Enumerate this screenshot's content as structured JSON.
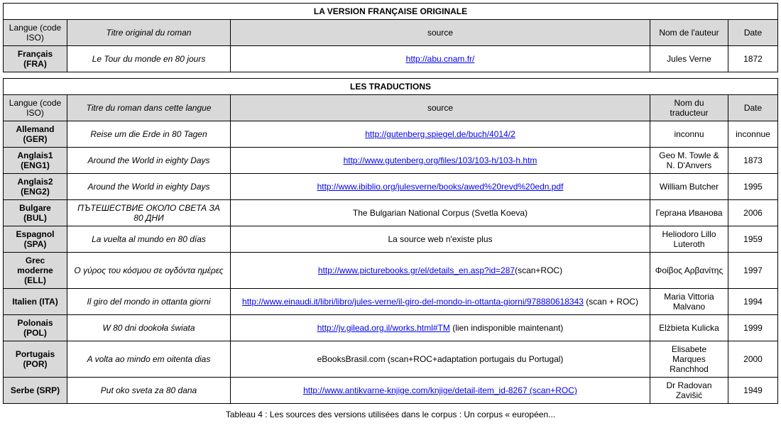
{
  "table1": {
    "title": "LA VERSION FRANÇAISE ORIGINALE",
    "headers": {
      "lang": "Langue (code ISO)",
      "titre": "Titre original du roman",
      "source": "source",
      "nom": "Nom de l'auteur",
      "date": "Date"
    },
    "rows": [
      {
        "lang": "Français (FRA)",
        "titre": "Le Tour du monde en 80 jours",
        "source_link": "http://abu.cnam.fr/",
        "source_extra": "",
        "nom": "Jules Verne",
        "date": "1872"
      }
    ]
  },
  "table2": {
    "title": "LES TRADUCTIONS",
    "headers": {
      "lang": "Langue (code ISO)",
      "titre": "Titre du roman dans cette langue",
      "source": "source",
      "nom": "Nom du traducteur",
      "date": "Date"
    },
    "rows": [
      {
        "lang": "Allemand (GER)",
        "titre": "Reise um die Erde in 80 Tagen",
        "source_link": "http://gutenberg.spiegel.de/buch/4014/2",
        "source_extra": "",
        "nom": "inconnu",
        "date": "inconnue"
      },
      {
        "lang": "Anglais1 (ENG1)",
        "titre": "Around the World in eighty Days",
        "source_link": "http://www.gutenberg.org/files/103/103-h/103-h.htm",
        "source_extra": "",
        "nom": "Geo M. Towle & N. D'Anvers",
        "date": "1873"
      },
      {
        "lang": "Anglais2 (ENG2)",
        "titre": "Around the World in eighty Days",
        "source_link": "http://www.ibiblio.org/julesverne/books/awed%20revd%20edn.pdf",
        "source_extra": "",
        "nom": "William Butcher",
        "date": "1995"
      },
      {
        "lang": "Bulgare (BUL)",
        "titre": "ПЪТЕШЕСТВИЕ ОКОЛО СВЕТА ЗА 80 ДНИ",
        "source_link": "",
        "source_extra": "The Bulgarian National Corpus (Svetla Koeva)",
        "nom": "Гергана Иванова",
        "date": "2006"
      },
      {
        "lang": "Espagnol (SPA)",
        "titre": "La vuelta al mundo en 80 días",
        "source_link": "",
        "source_extra": "La source web n'existe plus",
        "nom": "Heliodoro Lillo Luteroth",
        "date": "1959"
      },
      {
        "lang": "Grec moderne (ELL)",
        "titre": "Ο γύρος του κόσμου σε ογδόντα ημέρες",
        "source_link": "http://www.picturebooks.gr/el/details_en.asp?id=287",
        "source_extra": "(scan+ROC)",
        "nom": "Φοίβος Αρβανίτης",
        "date": "1997"
      },
      {
        "lang": "Italien (ITA)",
        "titre": "Il giro del mondo in ottanta giorni",
        "source_link": "http://www.einaudi.it/libri/libro/jules-verne/il-giro-del-mondo-in-ottanta-giorni/978880618343",
        "source_extra": " (scan + ROC)",
        "nom": "Maria Vittoria Malvano",
        "date": "1994"
      },
      {
        "lang": "Polonais (POL)",
        "titre": "W 80 dni dookoła świata",
        "source_link": "http://jv.gilead.org.il/works.html#TM",
        "source_extra": " (lien indisponible maintenant)",
        "nom": "Elżbieta Kulicka",
        "date": "1999"
      },
      {
        "lang": "Portugais (POR)",
        "titre": "A volta ao mindo em oitenta dias",
        "source_link": "",
        "source_extra": "eBooksBrasil.com (scan+ROC+adaptation portugais du Portugal)",
        "nom": "Elisabete Marques Ranchhod",
        "date": "2000"
      },
      {
        "lang": "Serbe (SRP)",
        "titre": "Put oko sveta za 80 dana",
        "source_link": "http://www.antikvarne-knjige.com/knjige/detail-item_id-8267 (scan+ROC)",
        "source_extra": "",
        "nom": "Dr Radovan Zavišić",
        "date": "1949"
      }
    ]
  },
  "caption": "Tableau 4 : Les sources des versions utilisées dans le corpus : Un corpus « européen..."
}
